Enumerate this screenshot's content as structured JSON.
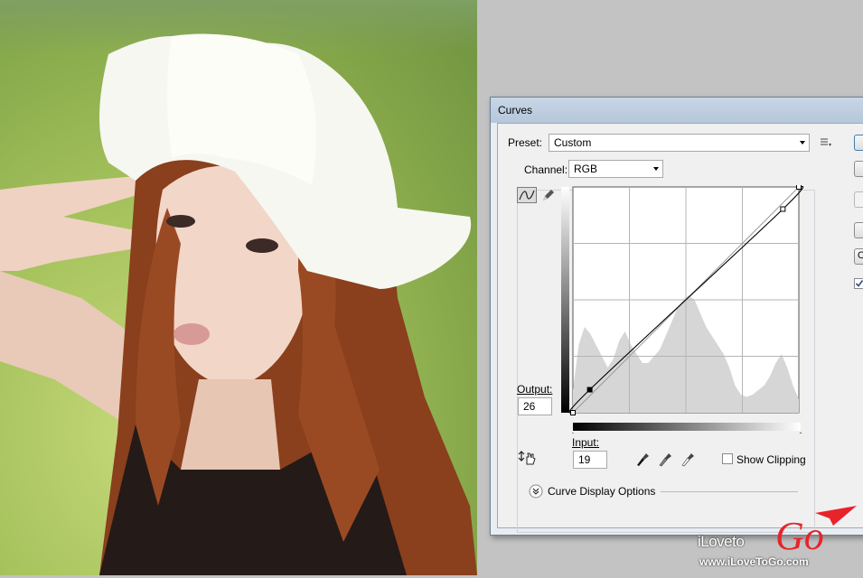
{
  "dialog": {
    "title": "Curves",
    "preset_label": "Preset:",
    "preset_value": "Custom",
    "channel_label": "Channel:",
    "channel_value": "RGB",
    "output_label": "Output:",
    "output_value": "26",
    "input_label": "Input:",
    "input_value": "19",
    "show_clipping_label": "Show Clipping",
    "curve_display_options_label": "Curve Display Options",
    "side_button_o_label": "O"
  },
  "watermark": {
    "brand_prefix": "iLoveto",
    "brand_suffix": "Go",
    "url": "www.iLoveToGo.com",
    "accent_color": "#e8232a"
  },
  "curve": {
    "control_points": [
      [
        0,
        0
      ],
      [
        19,
        26
      ],
      [
        237,
        230
      ],
      [
        255,
        255
      ]
    ],
    "histogram_levels": [
      0.1,
      0.3,
      0.38,
      0.35,
      0.3,
      0.25,
      0.2,
      0.24,
      0.32,
      0.36,
      0.3,
      0.26,
      0.22,
      0.22,
      0.25,
      0.28,
      0.34,
      0.4,
      0.46,
      0.5,
      0.52,
      0.5,
      0.44,
      0.38,
      0.34,
      0.3,
      0.26,
      0.2,
      0.12,
      0.08,
      0.07,
      0.08,
      0.1,
      0.12,
      0.16,
      0.22,
      0.26,
      0.2,
      0.12,
      0.06
    ]
  },
  "icons": [
    "curve-tool-icon",
    "pencil-icon",
    "preset-menu-icon",
    "hand-target-icon",
    "black-eyedropper-icon",
    "gray-eyedropper-icon",
    "white-eyedropper-icon",
    "expand-chevron-icon"
  ]
}
